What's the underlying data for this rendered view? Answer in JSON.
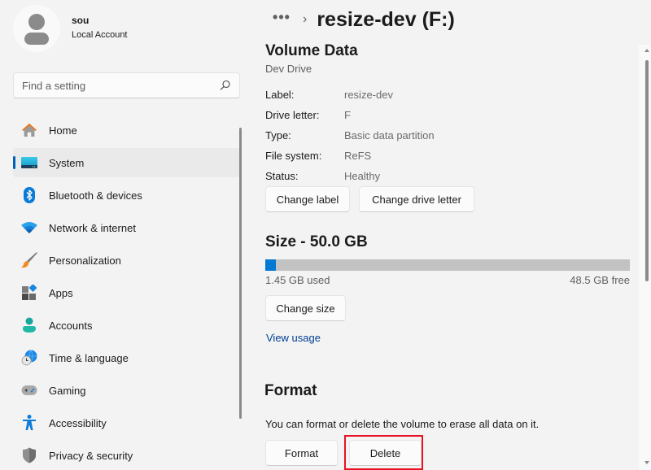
{
  "profile": {
    "name": "sou",
    "account_type": "Local Account"
  },
  "search": {
    "placeholder": "Find a setting",
    "value": ""
  },
  "sidebar": {
    "items": [
      {
        "label": "Home",
        "icon": "home-icon",
        "active": false
      },
      {
        "label": "System",
        "icon": "system-icon",
        "active": true
      },
      {
        "label": "Bluetooth & devices",
        "icon": "bluetooth-icon",
        "active": false
      },
      {
        "label": "Network & internet",
        "icon": "wifi-icon",
        "active": false
      },
      {
        "label": "Personalization",
        "icon": "brush-icon",
        "active": false
      },
      {
        "label": "Apps",
        "icon": "apps-icon",
        "active": false
      },
      {
        "label": "Accounts",
        "icon": "accounts-icon",
        "active": false
      },
      {
        "label": "Time & language",
        "icon": "globe-clock-icon",
        "active": false
      },
      {
        "label": "Gaming",
        "icon": "gamepad-icon",
        "active": false
      },
      {
        "label": "Accessibility",
        "icon": "accessibility-icon",
        "active": false
      },
      {
        "label": "Privacy & security",
        "icon": "shield-icon",
        "active": false
      }
    ]
  },
  "breadcrumb": {
    "more": "•••",
    "separator": "›",
    "title": "resize-dev (F:)"
  },
  "volume": {
    "title": "Volume Data",
    "subtitle": "Dev Drive",
    "properties": [
      {
        "key": "Label:",
        "value": "resize-dev"
      },
      {
        "key": "Drive letter:",
        "value": "F"
      },
      {
        "key": "Type:",
        "value": "Basic data partition"
      },
      {
        "key": "File system:",
        "value": "ReFS"
      },
      {
        "key": "Status:",
        "value": "Healthy"
      }
    ],
    "change_label_button": "Change label",
    "change_drive_letter_button": "Change drive letter"
  },
  "size": {
    "title": "Size - 50.0 GB",
    "used_label": "1.45 GB used",
    "free_label": "48.5 GB free",
    "used_fraction": 0.029,
    "change_size_button": "Change size",
    "view_usage_link": "View usage"
  },
  "format": {
    "title": "Format",
    "description": "You can format or delete the volume to erase all data on it.",
    "format_button": "Format",
    "delete_button": "Delete"
  },
  "colors": {
    "accent": "#0078d4",
    "link": "#003e92",
    "highlight": "#e81123",
    "usage_track": "#c2c2c2"
  }
}
